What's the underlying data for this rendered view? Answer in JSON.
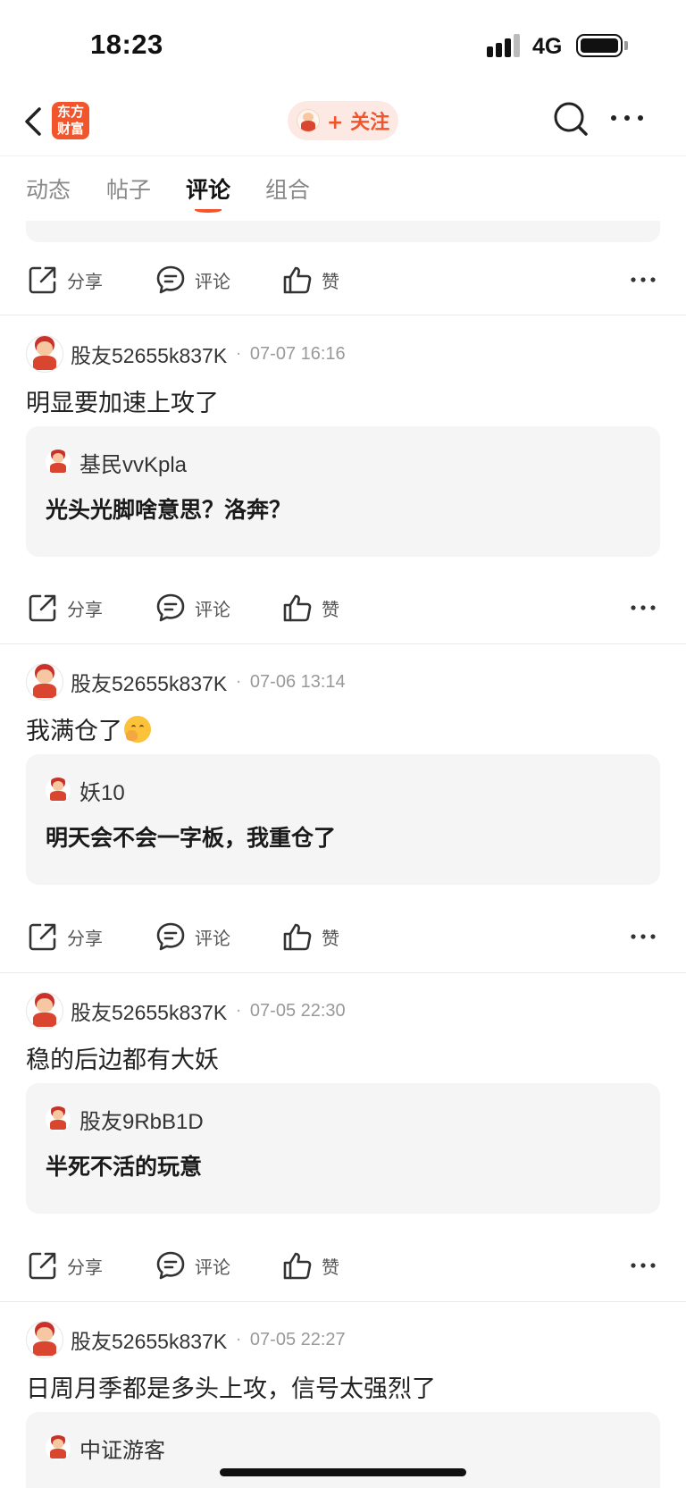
{
  "status": {
    "time": "18:23",
    "network": "4G"
  },
  "nav": {
    "logo_line1": "东方",
    "logo_line2": "财富",
    "follow_label": "+ 关注"
  },
  "tabs": [
    {
      "label": "动态"
    },
    {
      "label": "帖子"
    },
    {
      "label": "评论"
    },
    {
      "label": "组合"
    }
  ],
  "actions": {
    "share": "分享",
    "comment": "评论",
    "like": "赞"
  },
  "comments": [
    {
      "user": "股友52655k837K",
      "time": "07-07 16:16",
      "text": "明显要加速上攻了",
      "reply": {
        "user": "基民vvKpla",
        "text": "光头光脚啥意思？洛奔？"
      }
    },
    {
      "user": "股友52655k837K",
      "time": "07-06 13:14",
      "text": "我满仓了",
      "emoji": "hand-over-mouth-emoji",
      "reply": {
        "user": "妖10",
        "text": "明天会不会一字板，我重仓了"
      }
    },
    {
      "user": "股友52655k837K",
      "time": "07-05 22:30",
      "text": "稳的后边都有大妖",
      "reply": {
        "user": "股友9RbB1D",
        "text": "半死不活的玩意"
      }
    },
    {
      "user": "股友52655k837K",
      "time": "07-05 22:27",
      "text": "日周月季都是多头上攻，信号太强烈了",
      "reply": {
        "user": "中证游客",
        "text": ""
      }
    }
  ],
  "colors": {
    "accent": "#f2552c",
    "reply_bg": "#f5f5f5"
  }
}
